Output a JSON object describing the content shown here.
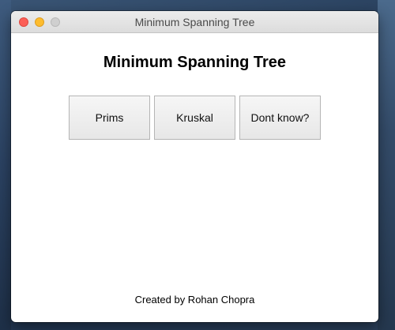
{
  "window": {
    "title": "Minimum Spanning Tree"
  },
  "titlebar": {
    "close_icon": "close-icon",
    "minimize_icon": "minimize-icon",
    "zoom_icon": "zoom-icon",
    "colors": {
      "close": "#fc5f57",
      "minimize": "#fdbc2e",
      "zoom_disabled": "#cfcfcf"
    }
  },
  "main": {
    "heading": "Minimum Spanning Tree",
    "buttons": [
      {
        "label": "Prims"
      },
      {
        "label": "Kruskal"
      },
      {
        "label": "Dont know?"
      }
    ],
    "footer": "Created by Rohan Chopra"
  }
}
